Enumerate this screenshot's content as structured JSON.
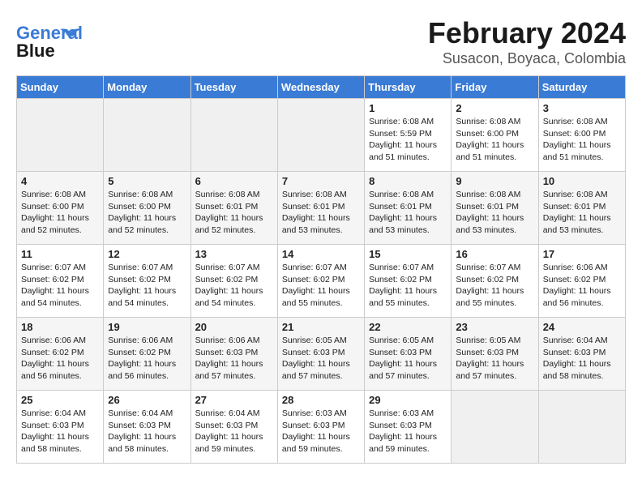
{
  "header": {
    "logo_line1": "General",
    "logo_line2": "Blue",
    "month_title": "February 2024",
    "location": "Susacon, Boyaca, Colombia"
  },
  "days_of_week": [
    "Sunday",
    "Monday",
    "Tuesday",
    "Wednesday",
    "Thursday",
    "Friday",
    "Saturday"
  ],
  "weeks": [
    [
      {
        "day": "",
        "info": ""
      },
      {
        "day": "",
        "info": ""
      },
      {
        "day": "",
        "info": ""
      },
      {
        "day": "",
        "info": ""
      },
      {
        "day": "1",
        "info": "Sunrise: 6:08 AM\nSunset: 5:59 PM\nDaylight: 11 hours and 51 minutes."
      },
      {
        "day": "2",
        "info": "Sunrise: 6:08 AM\nSunset: 6:00 PM\nDaylight: 11 hours and 51 minutes."
      },
      {
        "day": "3",
        "info": "Sunrise: 6:08 AM\nSunset: 6:00 PM\nDaylight: 11 hours and 51 minutes."
      }
    ],
    [
      {
        "day": "4",
        "info": "Sunrise: 6:08 AM\nSunset: 6:00 PM\nDaylight: 11 hours and 52 minutes."
      },
      {
        "day": "5",
        "info": "Sunrise: 6:08 AM\nSunset: 6:00 PM\nDaylight: 11 hours and 52 minutes."
      },
      {
        "day": "6",
        "info": "Sunrise: 6:08 AM\nSunset: 6:01 PM\nDaylight: 11 hours and 52 minutes."
      },
      {
        "day": "7",
        "info": "Sunrise: 6:08 AM\nSunset: 6:01 PM\nDaylight: 11 hours and 53 minutes."
      },
      {
        "day": "8",
        "info": "Sunrise: 6:08 AM\nSunset: 6:01 PM\nDaylight: 11 hours and 53 minutes."
      },
      {
        "day": "9",
        "info": "Sunrise: 6:08 AM\nSunset: 6:01 PM\nDaylight: 11 hours and 53 minutes."
      },
      {
        "day": "10",
        "info": "Sunrise: 6:08 AM\nSunset: 6:01 PM\nDaylight: 11 hours and 53 minutes."
      }
    ],
    [
      {
        "day": "11",
        "info": "Sunrise: 6:07 AM\nSunset: 6:02 PM\nDaylight: 11 hours and 54 minutes."
      },
      {
        "day": "12",
        "info": "Sunrise: 6:07 AM\nSunset: 6:02 PM\nDaylight: 11 hours and 54 minutes."
      },
      {
        "day": "13",
        "info": "Sunrise: 6:07 AM\nSunset: 6:02 PM\nDaylight: 11 hours and 54 minutes."
      },
      {
        "day": "14",
        "info": "Sunrise: 6:07 AM\nSunset: 6:02 PM\nDaylight: 11 hours and 55 minutes."
      },
      {
        "day": "15",
        "info": "Sunrise: 6:07 AM\nSunset: 6:02 PM\nDaylight: 11 hours and 55 minutes."
      },
      {
        "day": "16",
        "info": "Sunrise: 6:07 AM\nSunset: 6:02 PM\nDaylight: 11 hours and 55 minutes."
      },
      {
        "day": "17",
        "info": "Sunrise: 6:06 AM\nSunset: 6:02 PM\nDaylight: 11 hours and 56 minutes."
      }
    ],
    [
      {
        "day": "18",
        "info": "Sunrise: 6:06 AM\nSunset: 6:02 PM\nDaylight: 11 hours and 56 minutes."
      },
      {
        "day": "19",
        "info": "Sunrise: 6:06 AM\nSunset: 6:02 PM\nDaylight: 11 hours and 56 minutes."
      },
      {
        "day": "20",
        "info": "Sunrise: 6:06 AM\nSunset: 6:03 PM\nDaylight: 11 hours and 57 minutes."
      },
      {
        "day": "21",
        "info": "Sunrise: 6:05 AM\nSunset: 6:03 PM\nDaylight: 11 hours and 57 minutes."
      },
      {
        "day": "22",
        "info": "Sunrise: 6:05 AM\nSunset: 6:03 PM\nDaylight: 11 hours and 57 minutes."
      },
      {
        "day": "23",
        "info": "Sunrise: 6:05 AM\nSunset: 6:03 PM\nDaylight: 11 hours and 57 minutes."
      },
      {
        "day": "24",
        "info": "Sunrise: 6:04 AM\nSunset: 6:03 PM\nDaylight: 11 hours and 58 minutes."
      }
    ],
    [
      {
        "day": "25",
        "info": "Sunrise: 6:04 AM\nSunset: 6:03 PM\nDaylight: 11 hours and 58 minutes."
      },
      {
        "day": "26",
        "info": "Sunrise: 6:04 AM\nSunset: 6:03 PM\nDaylight: 11 hours and 58 minutes."
      },
      {
        "day": "27",
        "info": "Sunrise: 6:04 AM\nSunset: 6:03 PM\nDaylight: 11 hours and 59 minutes."
      },
      {
        "day": "28",
        "info": "Sunrise: 6:03 AM\nSunset: 6:03 PM\nDaylight: 11 hours and 59 minutes."
      },
      {
        "day": "29",
        "info": "Sunrise: 6:03 AM\nSunset: 6:03 PM\nDaylight: 11 hours and 59 minutes."
      },
      {
        "day": "",
        "info": ""
      },
      {
        "day": "",
        "info": ""
      }
    ]
  ]
}
